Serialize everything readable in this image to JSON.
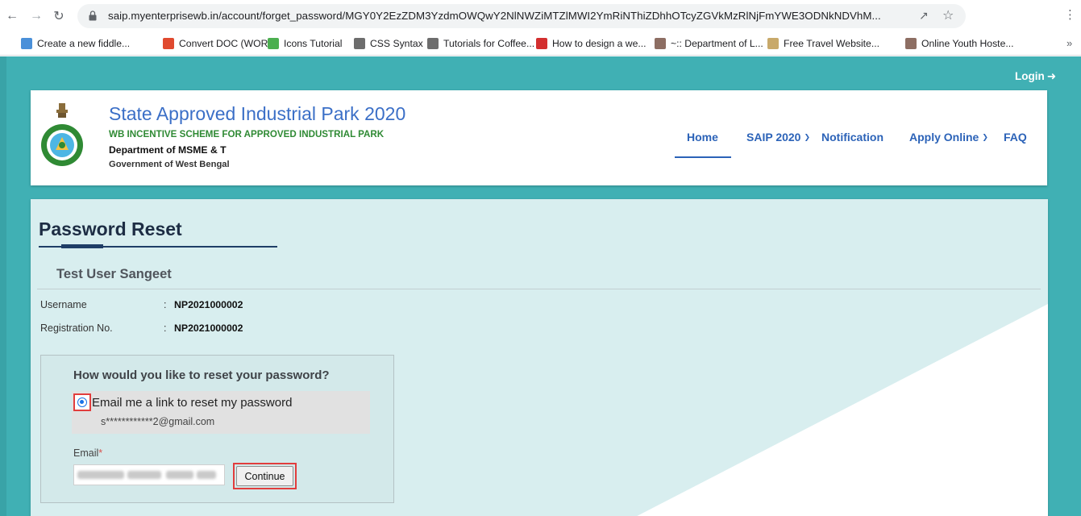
{
  "browser": {
    "url": "saip.myenterprisewb.in/account/forget_password/MGY0Y2EzZDM3YzdmOWQwY2NlNWZiMTZlMWI2YmRiNThiZDhhOTcyZGVkMzRlNjFmYWE3ODNkNDVhM...",
    "bookmarks": [
      {
        "label": "Create a new fiddle...",
        "icon": "jsfiddle-icon",
        "color": "#4a90d9"
      },
      {
        "label": "Convert DOC (WOR...",
        "icon": "convert-icon",
        "color": "#e04a2f"
      },
      {
        "label": "Icons Tutorial",
        "icon": "w3schools-icon",
        "color": "#4caf50"
      },
      {
        "label": "CSS Syntax",
        "icon": "css-icon",
        "color": "#6d6d6d"
      },
      {
        "label": "Tutorials for Coffee...",
        "icon": "tutorials-icon",
        "color": "#6d6d6d"
      },
      {
        "label": "How to design a we...",
        "icon": "design-icon",
        "color": "#d32f2f"
      },
      {
        "label": "~:: Department of L...",
        "icon": "emblem-icon",
        "color": "#8d6e63"
      },
      {
        "label": "Free Travel Website...",
        "icon": "travel-icon",
        "color": "#c8a96a"
      },
      {
        "label": "Online Youth Hoste...",
        "icon": "emblem-icon",
        "color": "#8d6e63"
      }
    ]
  },
  "header": {
    "login": "Login",
    "title": "State Approved Industrial Park 2020",
    "subtitle": "WB INCENTIVE SCHEME FOR APPROVED INDUSTRIAL PARK",
    "department": "Department of MSME & T",
    "government": "Government of West Bengal",
    "nav": [
      {
        "label": "Home"
      },
      {
        "label": "SAIP 2020"
      },
      {
        "label": "Notification"
      },
      {
        "label": "Apply Online"
      },
      {
        "label": "FAQ"
      }
    ]
  },
  "main": {
    "title": "Password Reset",
    "user_name": "Test User Sangeet",
    "fields": [
      {
        "label": "Username",
        "value": "NP2021000002"
      },
      {
        "label": "Registration No.",
        "value": "NP2021000002"
      }
    ],
    "question": "How would you like to reset your password?",
    "option_label": "Email me a link to reset my password",
    "masked_email": "s************2@gmail.com",
    "email_label": "Email",
    "required_mark": "*",
    "continue_label": "Continue"
  },
  "colors": {
    "teal_background": "#40b0b4",
    "title_blue": "#3b6fc7",
    "subtitle_green": "#2f8a34",
    "nav_blue": "#2c63b8",
    "highlight_red": "#e23d3d"
  }
}
